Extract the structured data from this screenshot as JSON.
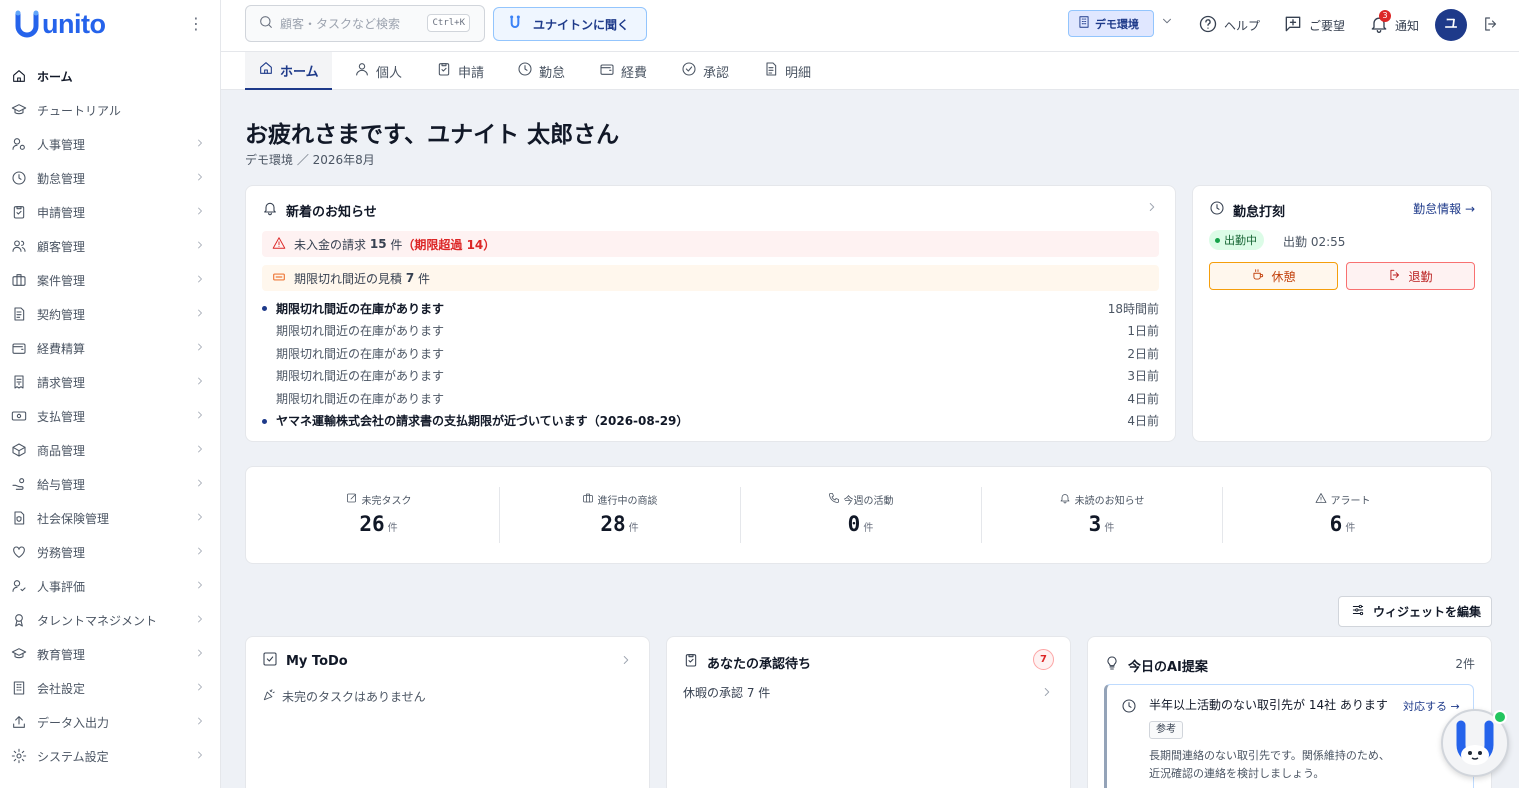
{
  "app": {
    "logo_text": "unito",
    "logo_mark": "U"
  },
  "sidebar": {
    "items": [
      {
        "label": "ホーム",
        "icon": "home-icon",
        "active": true,
        "chevron": false
      },
      {
        "label": "チュートリアル",
        "icon": "graduation-cap-icon",
        "active": false,
        "chevron": false
      },
      {
        "label": "人事管理",
        "icon": "user-cog-icon",
        "active": false,
        "chevron": true
      },
      {
        "label": "勤怠管理",
        "icon": "clock-icon",
        "active": false,
        "chevron": true
      },
      {
        "label": "申請管理",
        "icon": "clipboard-check-icon",
        "active": false,
        "chevron": true
      },
      {
        "label": "顧客管理",
        "icon": "users-icon",
        "active": false,
        "chevron": true
      },
      {
        "label": "案件管理",
        "icon": "briefcase-icon",
        "active": false,
        "chevron": true
      },
      {
        "label": "契約管理",
        "icon": "file-contract-icon",
        "active": false,
        "chevron": true
      },
      {
        "label": "経費精算",
        "icon": "wallet-icon",
        "active": false,
        "chevron": true
      },
      {
        "label": "請求管理",
        "icon": "receipt-icon",
        "active": false,
        "chevron": true
      },
      {
        "label": "支払管理",
        "icon": "banknote-icon",
        "active": false,
        "chevron": true
      },
      {
        "label": "商品管理",
        "icon": "package-icon",
        "active": false,
        "chevron": true
      },
      {
        "label": "給与管理",
        "icon": "hand-coins-icon",
        "active": false,
        "chevron": true
      },
      {
        "label": "社会保険管理",
        "icon": "file-shield-icon",
        "active": false,
        "chevron": true
      },
      {
        "label": "労務管理",
        "icon": "heart-handshake-icon",
        "active": false,
        "chevron": true
      },
      {
        "label": "人事評価",
        "icon": "user-check-icon",
        "active": false,
        "chevron": true
      },
      {
        "label": "タレントマネジメント",
        "icon": "award-icon",
        "active": false,
        "chevron": true
      },
      {
        "label": "教育管理",
        "icon": "school-icon",
        "active": false,
        "chevron": true
      },
      {
        "label": "会社設定",
        "icon": "building-icon",
        "active": false,
        "chevron": true
      },
      {
        "label": "データ入出力",
        "icon": "upload-icon",
        "active": false,
        "chevron": true
      },
      {
        "label": "システム設定",
        "icon": "gear-icon",
        "active": false,
        "chevron": true
      }
    ]
  },
  "topbar": {
    "search_placeholder": "顧客・タスクなど検索",
    "search_shortcut": "Ctrl+K",
    "ask_label": "ユナイトンに聞く",
    "env_label": "デモ環境",
    "help_label": "ヘルプ",
    "request_label": "ご要望",
    "notify_label": "通知",
    "notify_count": "3",
    "avatar_initial": "ユ"
  },
  "tabs": [
    {
      "label": "ホーム",
      "icon": "home-icon",
      "active": true
    },
    {
      "label": "個人",
      "icon": "user-icon",
      "active": false
    },
    {
      "label": "申請",
      "icon": "clipboard-check-icon",
      "active": false
    },
    {
      "label": "勤怠",
      "icon": "clock-icon",
      "active": false
    },
    {
      "label": "経費",
      "icon": "wallet-icon",
      "active": false
    },
    {
      "label": "承認",
      "icon": "check-circle-icon",
      "active": false
    },
    {
      "label": "明細",
      "icon": "file-text-icon",
      "active": false
    }
  ],
  "greeting": {
    "title": "お疲れさまです、ユナイト 太郎さん",
    "breadcrumb": "デモ環境 ／ 2026年8月"
  },
  "news": {
    "title": "新着のお知らせ",
    "alert_unpaid_prefix": "未入金の請求",
    "alert_unpaid_count": "15",
    "alert_unpaid_unit": "件",
    "alert_unpaid_overdue": "（期限超過 14）",
    "alert_quote_prefix": "期限切れ間近の見積",
    "alert_quote_count": "7",
    "alert_quote_unit": "件",
    "items": [
      {
        "text": "期限切れ間近の在庫があります",
        "time": "18時間前",
        "unread": true
      },
      {
        "text": "期限切れ間近の在庫があります",
        "time": "1日前",
        "unread": false
      },
      {
        "text": "期限切れ間近の在庫があります",
        "time": "2日前",
        "unread": false
      },
      {
        "text": "期限切れ間近の在庫があります",
        "time": "3日前",
        "unread": false
      },
      {
        "text": "期限切れ間近の在庫があります",
        "time": "4日前",
        "unread": false
      },
      {
        "text": "ヤマネ運輸株式会社の請求書の支払期限が近づいています（2026-08-29）",
        "time": "4日前",
        "unread": true
      }
    ]
  },
  "attendance": {
    "title": "勤怠打刻",
    "link": "勤怠情報 →",
    "status": "出勤中",
    "clock_in": "出勤 02:55",
    "break_label": "休憩",
    "leave_label": "退勤"
  },
  "stats": [
    {
      "label": "未完タスク",
      "value": "26",
      "unit": "件",
      "icon": "edit-square-icon"
    },
    {
      "label": "進行中の商談",
      "value": "28",
      "unit": "件",
      "icon": "briefcase-icon"
    },
    {
      "label": "今週の活動",
      "value": "0",
      "unit": "件",
      "icon": "phone-icon"
    },
    {
      "label": "未読のお知らせ",
      "value": "3",
      "unit": "件",
      "icon": "bell-icon"
    },
    {
      "label": "アラート",
      "value": "6",
      "unit": "件",
      "icon": "warning-icon"
    }
  ],
  "widgets": {
    "edit_label": "ウィジェットを編集",
    "todo": {
      "title": "My ToDo",
      "empty": "未完のタスクはありません"
    },
    "approval": {
      "title": "あなたの承認待ち",
      "count": "7",
      "item": "休暇の承認 7 件"
    },
    "ai": {
      "title": "今日のAI提案",
      "count": "2件",
      "suggestion": "半年以上活動のない取引先が 14社 あります",
      "action": "対応する →",
      "tag": "参考",
      "desc1": "長期間連絡のない取引先です。関係維持のため、",
      "desc2": "近況確認の連絡を検討しましょう。"
    }
  },
  "colors": {
    "brand": "#2563eb",
    "navy": "#1e3a8a",
    "danger": "#dc2626",
    "success": "#16a34a",
    "warn_bg": "#fef2f2",
    "orange_bg": "#fff7ed"
  }
}
